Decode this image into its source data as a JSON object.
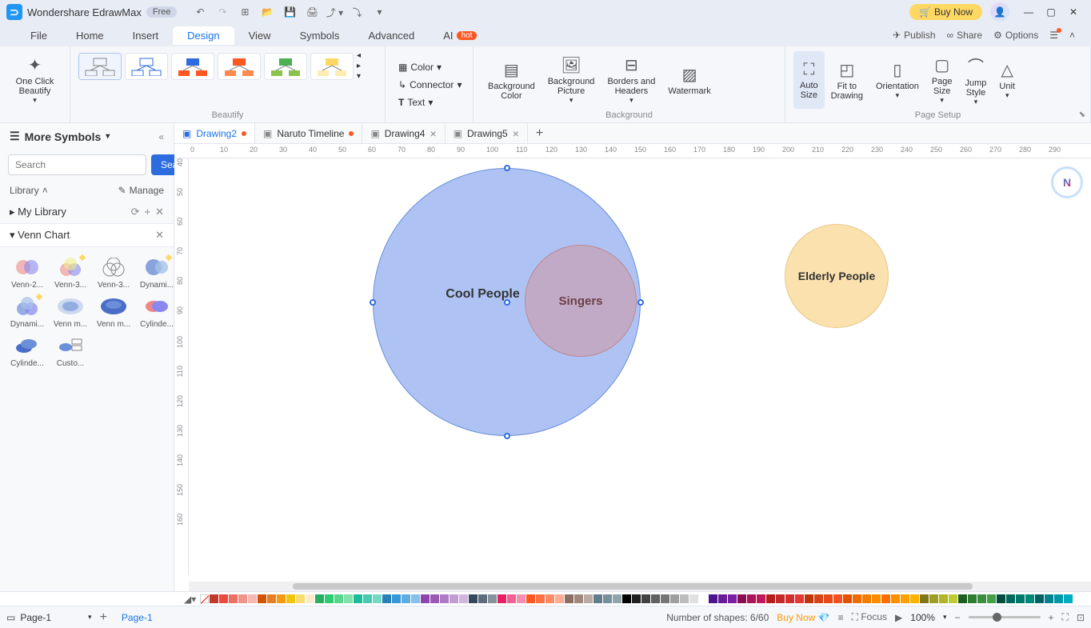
{
  "titlebar": {
    "app_name": "Wondershare EdrawMax",
    "free_badge": "Free",
    "buy_now": "Buy Now"
  },
  "menu": {
    "items": [
      "File",
      "Home",
      "Insert",
      "Design",
      "View",
      "Symbols",
      "Advanced"
    ],
    "ai": "AI",
    "hot": "hot",
    "right": {
      "publish": "Publish",
      "share": "Share",
      "options": "Options"
    }
  },
  "ribbon": {
    "one_click": "One Click\nBeautify",
    "beautify_label": "Beautify",
    "color": "Color",
    "connector": "Connector",
    "text": "Text",
    "bg_color": "Background\nColor",
    "bg_picture": "Background\nPicture",
    "borders": "Borders and\nHeaders",
    "watermark": "Watermark",
    "bg_label": "Background",
    "auto_size": "Auto\nSize",
    "fit": "Fit to\nDrawing",
    "orientation": "Orientation",
    "page_size": "Page\nSize",
    "jump_style": "Jump\nStyle",
    "unit": "Unit",
    "page_setup_label": "Page Setup"
  },
  "left": {
    "more_symbols": "More Symbols",
    "search_placeholder": "Search",
    "search_btn": "Search",
    "library": "Library",
    "manage": "Manage",
    "my_library": "My Library",
    "venn_chart": "Venn Chart",
    "shapes": [
      "Venn-2...",
      "Venn-3...",
      "Venn-3...",
      "Dynami...",
      "Dynami...",
      "Venn m...",
      "Venn m...",
      "Cylinde...",
      "Cylinde...",
      "Custo..."
    ]
  },
  "tabs": [
    {
      "label": "Drawing2",
      "active": true,
      "dirty": true
    },
    {
      "label": "Naruto Timeline",
      "active": false,
      "dirty": true
    },
    {
      "label": "Drawing4",
      "active": false,
      "closable": true
    },
    {
      "label": "Drawing5",
      "active": false,
      "closable": true
    }
  ],
  "canvas": {
    "circles": {
      "cool": "Cool People",
      "singers": "Singers",
      "elderly": "Elderly People"
    }
  },
  "status": {
    "page_cur": "Page-1",
    "page_tab": "Page-1",
    "shapes_count": "Number of shapes: 6/60",
    "buy_now": "Buy Now",
    "focus": "Focus",
    "zoom": "100%"
  },
  "ruler_h": [
    0,
    10,
    20,
    30,
    40,
    50,
    60,
    70,
    80,
    90,
    100,
    110,
    120,
    130,
    140,
    150,
    160,
    170,
    180,
    190,
    200,
    210,
    220,
    230,
    240,
    250,
    260,
    270,
    280,
    290
  ],
  "ruler_v": [
    40,
    50,
    60,
    70,
    80,
    90,
    100,
    110,
    120,
    130,
    140,
    150,
    160
  ]
}
